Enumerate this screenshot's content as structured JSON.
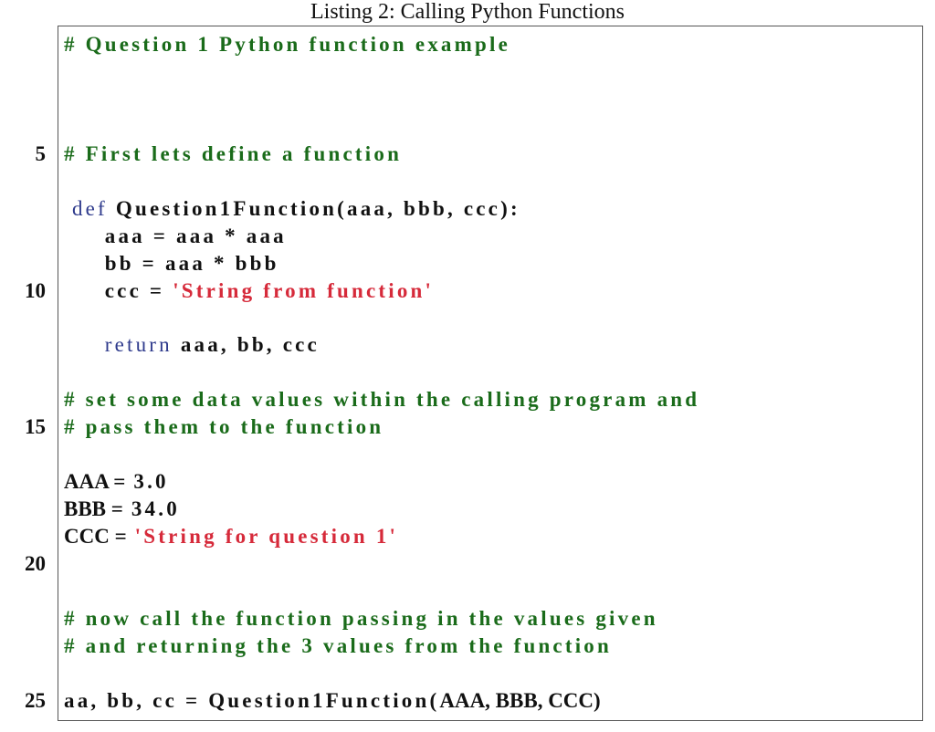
{
  "caption": "Listing 2: Calling Python Functions",
  "colors": {
    "comment": "#1a6b1a",
    "string": "#d62a3a",
    "keyword": "#2e3a8c",
    "text": "#111111",
    "border": "#555555"
  },
  "listing": {
    "language": "Python",
    "lines": [
      {
        "n": 1,
        "number_label": "",
        "tokens": [
          {
            "t": "comment",
            "v": "# Question 1 Python function example"
          }
        ]
      },
      {
        "n": 2,
        "number_label": "",
        "tokens": []
      },
      {
        "n": 3,
        "number_label": "",
        "tokens": []
      },
      {
        "n": 4,
        "number_label": "",
        "tokens": []
      },
      {
        "n": 5,
        "number_label": "5",
        "tokens": [
          {
            "t": "comment",
            "v": "# First lets define a function"
          }
        ]
      },
      {
        "n": 6,
        "number_label": "",
        "tokens": []
      },
      {
        "n": 7,
        "number_label": "",
        "tokens": [
          {
            "t": "keyword",
            "v": " def"
          },
          {
            "t": "plain",
            "v": " Question1Function(aaa, bbb, ccc):"
          }
        ]
      },
      {
        "n": 8,
        "number_label": "",
        "tokens": [
          {
            "t": "plain",
            "v": "     aaa = aaa * aaa"
          }
        ]
      },
      {
        "n": 9,
        "number_label": "",
        "tokens": [
          {
            "t": "plain",
            "v": "     bb = aaa * bbb"
          }
        ]
      },
      {
        "n": 10,
        "number_label": "10",
        "tokens": [
          {
            "t": "plain",
            "v": "     ccc = "
          },
          {
            "t": "string",
            "v": "'String from function'"
          }
        ]
      },
      {
        "n": 11,
        "number_label": "",
        "tokens": []
      },
      {
        "n": 12,
        "number_label": "",
        "tokens": [
          {
            "t": "plain",
            "v": "     "
          },
          {
            "t": "keyword",
            "v": "return"
          },
          {
            "t": "plain",
            "v": " aaa, bb, ccc"
          }
        ]
      },
      {
        "n": 13,
        "number_label": "",
        "tokens": []
      },
      {
        "n": 14,
        "number_label": "",
        "tokens": [
          {
            "t": "comment",
            "v": "# set some data values within the calling program and"
          }
        ]
      },
      {
        "n": 15,
        "number_label": "15",
        "tokens": [
          {
            "t": "comment",
            "v": "# pass them to the function"
          }
        ]
      },
      {
        "n": 16,
        "number_label": "",
        "tokens": []
      },
      {
        "n": 17,
        "number_label": "",
        "tokens": [
          {
            "t": "caps",
            "v": "AAA ="
          },
          {
            "t": "plain",
            "v": " 3.0"
          }
        ]
      },
      {
        "n": 18,
        "number_label": "",
        "tokens": [
          {
            "t": "caps",
            "v": "BBB ="
          },
          {
            "t": "plain",
            "v": " 34.0"
          }
        ]
      },
      {
        "n": 19,
        "number_label": "",
        "tokens": [
          {
            "t": "caps",
            "v": "CCC ="
          },
          {
            "t": "string",
            "v": " 'String for question 1'"
          }
        ]
      },
      {
        "n": 20,
        "number_label": "20",
        "tokens": []
      },
      {
        "n": 21,
        "number_label": "",
        "tokens": []
      },
      {
        "n": 22,
        "number_label": "",
        "tokens": [
          {
            "t": "comment",
            "v": "# now call the function passing in the values given"
          }
        ]
      },
      {
        "n": 23,
        "number_label": "",
        "tokens": [
          {
            "t": "comment",
            "v": "# and returning the 3 values from the function"
          }
        ]
      },
      {
        "n": 24,
        "number_label": "",
        "tokens": []
      },
      {
        "n": 25,
        "number_label": "25",
        "tokens": [
          {
            "t": "plain",
            "v": "aa, bb, cc = Question1Function("
          },
          {
            "t": "caps",
            "v": "AAA, BBB, CCC)"
          }
        ]
      }
    ]
  }
}
